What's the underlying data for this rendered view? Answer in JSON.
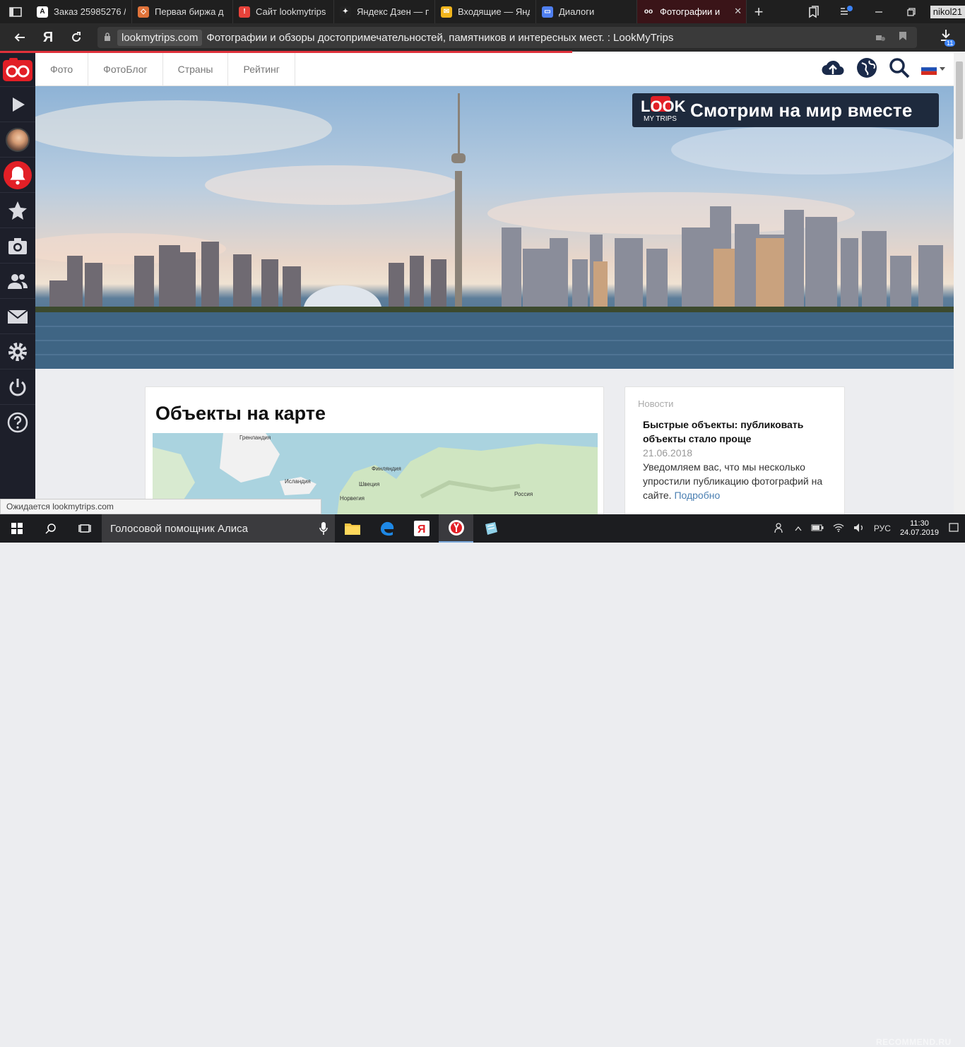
{
  "browser": {
    "tabs": [
      {
        "label": "Заказ 25985276 /",
        "fav_color": "#111",
        "fav_glyph": "A"
      },
      {
        "label": "Первая биржа д",
        "fav_color": "#e0733a",
        "fav_glyph": "◇"
      },
      {
        "label": "Сайт lookmytrips",
        "fav_color": "#e8423a",
        "fav_glyph": "!"
      },
      {
        "label": "Яндекс Дзен — п",
        "fav_color": "#222",
        "fav_glyph": "✦"
      },
      {
        "label": "Входящие — Янд",
        "fav_color": "#f1b51c",
        "fav_glyph": "✉"
      },
      {
        "label": "Диалоги",
        "fav_color": "#4f7ff0",
        "fav_glyph": "▭"
      },
      {
        "label": "Фотографии и",
        "fav_color": "#3a1418",
        "fav_glyph": "oo"
      }
    ],
    "user": "nikol21",
    "url_domain": "lookmytrips.com",
    "page_title": "Фотографии и обзоры достопримечательностей, памятников и интересных мест. : LookMyTrips",
    "downloads_count": "11",
    "yandex_glyph": "Я"
  },
  "sidebar": {
    "icons": [
      "play-icon",
      "avatar",
      "bell-icon",
      "star-icon",
      "camera-icon",
      "users-icon",
      "mail-icon",
      "gear-icon",
      "power-icon",
      "help-icon"
    ]
  },
  "topnav": {
    "links": [
      "Фото",
      "ФотоБлог",
      "Страны",
      "Рейтинг"
    ]
  },
  "hero": {
    "brand_logo": "LOOK",
    "brand_sub": "MY TRIPS",
    "tagline": "Смотрим на мир вместе"
  },
  "map_card": {
    "title": "Объекты на карте",
    "labels": [
      "Гренландия",
      "Исландия",
      "Финляндия",
      "Швеция",
      "Норвегия",
      "Россия"
    ]
  },
  "news": {
    "heading": "Новости",
    "title": "Быстрые объекты: публиковать объекты стало проще",
    "date": "21.06.2018",
    "text": "Уведомляем вас, что мы несколько упростили публикацию фотографий на сайте.",
    "more": "Подробно"
  },
  "status_text": "Ожидается lookmytrips.com",
  "taskbar": {
    "search_text": "Голосовой помощник Алиса",
    "lang": "РУС",
    "time": "11:30",
    "date": "24.07.2019",
    "watermark": "RECOMMEND.RU"
  }
}
